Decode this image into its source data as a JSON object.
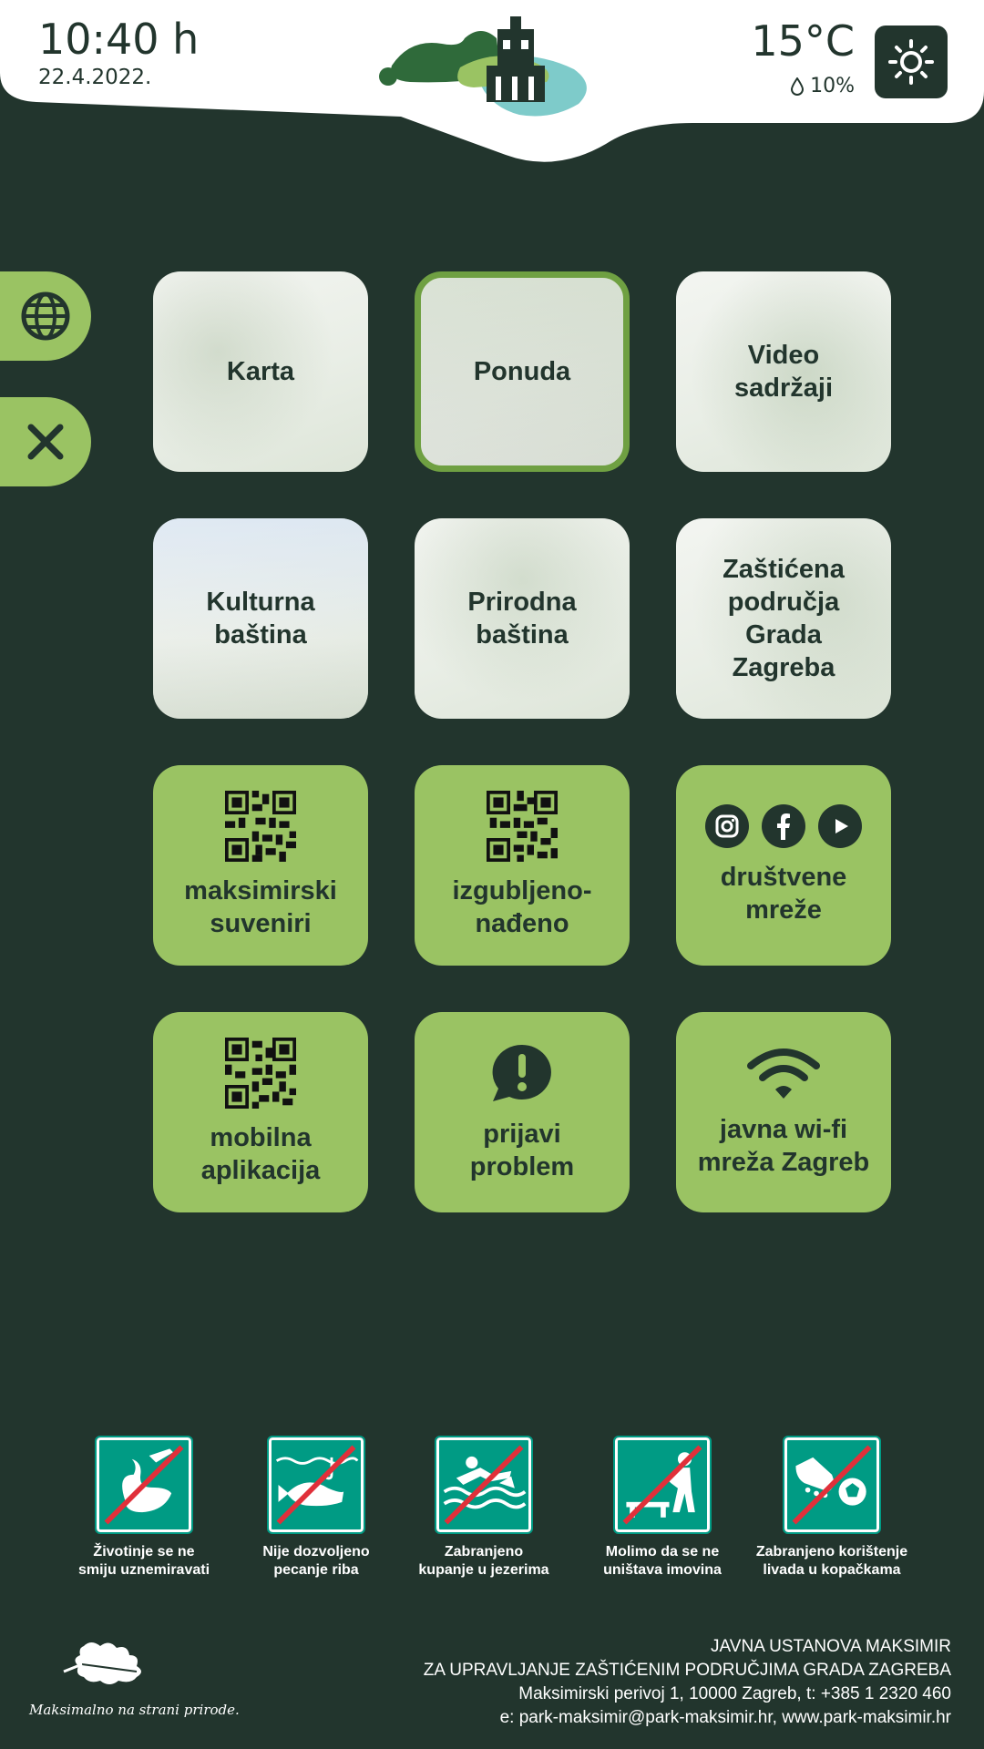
{
  "header": {
    "time": "10:40 h",
    "date": "22.4.2022.",
    "temperature": "15°C",
    "humidity": "10%",
    "weather_icon": "sun-icon"
  },
  "side_buttons": {
    "language_icon": "globe-icon",
    "close_icon": "close-icon"
  },
  "tiles": {
    "karta": "Karta",
    "ponuda": "Ponuda",
    "video": [
      "Video",
      "sadržaji"
    ],
    "kulturna": [
      "Kulturna",
      "baština"
    ],
    "prirodna": [
      "Prirodna",
      "baština"
    ],
    "zasticena": [
      "Zaštićena",
      "područja",
      "Grada",
      "Zagreba"
    ],
    "suveniri": [
      "maksimirski",
      "suveniri"
    ],
    "izgubljeno": [
      "izgubljeno-",
      "nađeno"
    ],
    "drustvene": [
      "društvene",
      "mreže"
    ],
    "mobilna": [
      "mobilna",
      "aplikacija"
    ],
    "prijavi": [
      "prijavi",
      "problem"
    ],
    "wifi": [
      "javna wi-fi",
      "mreža Zagreb"
    ]
  },
  "rules": [
    {
      "line1": "Životinje se ne",
      "line2": "smiju uznemiravati",
      "icon": "no-disturbing-animals-icon"
    },
    {
      "line1": "Nije dozvoljeno",
      "line2": "pecanje riba",
      "icon": "no-fishing-icon"
    },
    {
      "line1": "Zabranjeno",
      "line2": "kupanje u jezerima",
      "icon": "no-swimming-icon"
    },
    {
      "line1": "Molimo da se ne",
      "line2": "uništava imovina",
      "icon": "no-vandalism-icon"
    },
    {
      "line1": "Zabranjeno korištenje",
      "line2": "livada u kopačkama",
      "icon": "no-football-boots-icon"
    }
  ],
  "footer": {
    "tagline": "Maksimalno na strani prirode.",
    "line1": "JAVNA USTANOVA MAKSIMIR",
    "line2": "ZA UPRAVLJANJE ZAŠTIĆENIM PODRUČJIMA GRADA ZAGREBA",
    "line3": "Maksimirski perivoj 1, 10000 Zagreb, t: +385 1 2320 460",
    "line4": "e: park-maksimir@park-maksimir.hr, www.park-maksimir.hr"
  },
  "colors": {
    "background": "#22352d",
    "accent_green": "#9ac363",
    "sign_teal": "#009b84",
    "prohibition_red": "#e0303a"
  }
}
